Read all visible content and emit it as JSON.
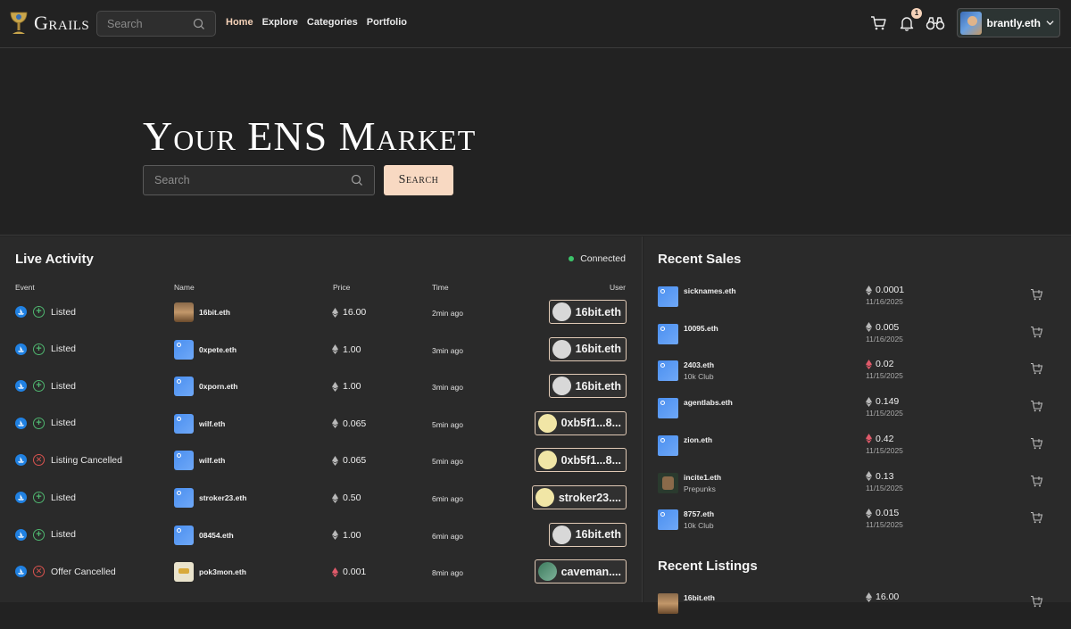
{
  "nav": {
    "logo_text": "Grails",
    "search_placeholder": "Search",
    "links": [
      {
        "label": "Home",
        "active": true
      },
      {
        "label": "Explore",
        "active": false
      },
      {
        "label": "Categories",
        "active": false
      },
      {
        "label": "Portfolio",
        "active": false
      }
    ],
    "notification_count": "1",
    "user_name": "brantly.eth",
    "icons": [
      "cart-icon",
      "bell-icon",
      "binoculars-icon",
      "chevron-down-icon"
    ]
  },
  "hero": {
    "title": "Your ENS Market",
    "search_placeholder": "Search",
    "search_button": "Search"
  },
  "activity": {
    "title": "Live Activity",
    "status": "Connected",
    "columns": {
      "event": "Event",
      "name": "Name",
      "price": "Price",
      "time": "Time",
      "user": "User"
    },
    "rows": [
      {
        "event": "Listed",
        "type": "plus",
        "name": "16bit.eth",
        "thumb": "face",
        "price": "16.00",
        "price_color": "#b8b8b8",
        "time": "2min ago",
        "user": "16bit.eth",
        "avatar": "gray"
      },
      {
        "event": "Listed",
        "type": "plus",
        "name": "0xpete.eth",
        "thumb": "ens",
        "price": "1.00",
        "price_color": "#b8b8b8",
        "time": "3min ago",
        "user": "16bit.eth",
        "avatar": "gray"
      },
      {
        "event": "Listed",
        "type": "plus",
        "name": "0xporn.eth",
        "thumb": "ens",
        "price": "1.00",
        "price_color": "#b8b8b8",
        "time": "3min ago",
        "user": "16bit.eth",
        "avatar": "gray"
      },
      {
        "event": "Listed",
        "type": "plus",
        "name": "wilf.eth",
        "thumb": "ens",
        "price": "0.065",
        "price_color": "#b8b8b8",
        "time": "5min ago",
        "user": "0xb5f1...8...",
        "avatar": "yellow"
      },
      {
        "event": "Listing Cancelled",
        "type": "x",
        "name": "wilf.eth",
        "thumb": "ens",
        "price": "0.065",
        "price_color": "#b8b8b8",
        "time": "5min ago",
        "user": "0xb5f1...8...",
        "avatar": "yellow"
      },
      {
        "event": "Listed",
        "type": "plus",
        "name": "stroker23.eth",
        "thumb": "ens",
        "price": "0.50",
        "price_color": "#b8b8b8",
        "time": "6min ago",
        "user": "stroker23....",
        "avatar": "yellow"
      },
      {
        "event": "Listed",
        "type": "plus",
        "name": "08454.eth",
        "thumb": "ens",
        "price": "1.00",
        "price_color": "#b8b8b8",
        "time": "6min ago",
        "user": "16bit.eth",
        "avatar": "gray"
      },
      {
        "event": "Offer Cancelled",
        "type": "x",
        "name": "pok3mon.eth",
        "thumb": "poke",
        "price": "0.001",
        "price_color": "#e05a6a",
        "time": "8min ago",
        "user": "caveman....",
        "avatar": "green"
      }
    ]
  },
  "sales": {
    "title": "Recent Sales",
    "items": [
      {
        "name": "sicknames.eth",
        "sub": "",
        "thumb": "ens",
        "price": "0.0001",
        "price_color": "#b8b8b8",
        "date": "11/16/2025"
      },
      {
        "name": "10095.eth",
        "sub": "",
        "thumb": "ens",
        "price": "0.005",
        "price_color": "#b8b8b8",
        "date": "11/16/2025"
      },
      {
        "name": "2403.eth",
        "sub": "10k Club",
        "thumb": "ens",
        "price": "0.02",
        "price_color": "#e05a6a",
        "date": "11/15/2025"
      },
      {
        "name": "agentlabs.eth",
        "sub": "",
        "thumb": "ens",
        "price": "0.149",
        "price_color": "#b8b8b8",
        "date": "11/15/2025"
      },
      {
        "name": "zion.eth",
        "sub": "",
        "thumb": "ens",
        "price": "0.42",
        "price_color": "#e05a6a",
        "date": "11/15/2025"
      },
      {
        "name": "incite1.eth",
        "sub": "Prepunks",
        "thumb": "punk",
        "price": "0.13",
        "price_color": "#b8b8b8",
        "date": "11/15/2025"
      },
      {
        "name": "8757.eth",
        "sub": "10k Club",
        "thumb": "ens",
        "price": "0.015",
        "price_color": "#b8b8b8",
        "date": "11/15/2025"
      }
    ]
  },
  "listings": {
    "title": "Recent Listings",
    "items": [
      {
        "name": "16bit.eth",
        "sub": "",
        "thumb": "face",
        "price": "16.00",
        "price_color": "#b8b8b8",
        "date": ""
      }
    ]
  }
}
